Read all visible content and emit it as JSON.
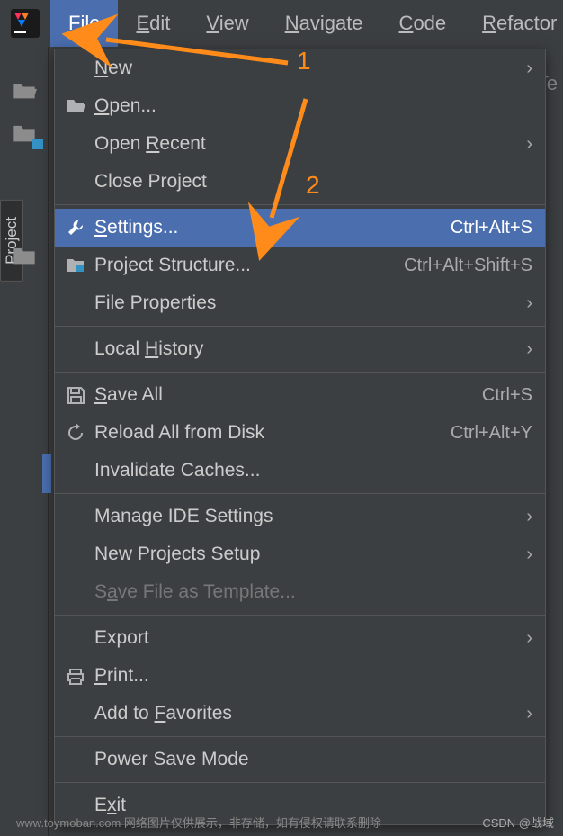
{
  "menubar": {
    "items": [
      {
        "label": "File",
        "mnemonic": 0
      },
      {
        "label": "Edit",
        "mnemonic": 0
      },
      {
        "label": "View",
        "mnemonic": 0
      },
      {
        "label": "Navigate",
        "mnemonic": 0
      },
      {
        "label": "Code",
        "mnemonic": 0
      },
      {
        "label": "Refactor",
        "mnemonic": 0
      }
    ]
  },
  "sidebar": {
    "vertical_tab": "Project"
  },
  "background_partial": "Te",
  "dropdown": {
    "groups": [
      [
        {
          "label": "New",
          "mnemonic": "N",
          "submenu": true
        },
        {
          "label": "Open...",
          "mnemonic": "O",
          "icon": "folder"
        },
        {
          "label": "Open Recent",
          "mnemonic": "R",
          "submenu": true
        },
        {
          "label": "Close Project"
        }
      ],
      [
        {
          "label": "Settings...",
          "mnemonic": "S",
          "icon": "wrench",
          "shortcut": "Ctrl+Alt+S",
          "selected": true
        },
        {
          "label": "Project Structure...",
          "icon": "structure",
          "shortcut": "Ctrl+Alt+Shift+S"
        },
        {
          "label": "File Properties",
          "submenu": true
        }
      ],
      [
        {
          "label": "Local History",
          "mnemonic": "H",
          "submenu": true
        }
      ],
      [
        {
          "label": "Save All",
          "mnemonic": "S",
          "icon": "save",
          "shortcut": "Ctrl+S"
        },
        {
          "label": "Reload All from Disk",
          "icon": "reload",
          "shortcut": "Ctrl+Alt+Y"
        },
        {
          "label": "Invalidate Caches..."
        }
      ],
      [
        {
          "label": "Manage IDE Settings",
          "submenu": true
        },
        {
          "label": "New Projects Setup",
          "submenu": true
        },
        {
          "label": "Save File as Template...",
          "mnemonic": "a",
          "disabled": true
        }
      ],
      [
        {
          "label": "Export",
          "submenu": true
        },
        {
          "label": "Print...",
          "mnemonic": "P",
          "icon": "print"
        },
        {
          "label": "Add to Favorites",
          "mnemonic": "F",
          "submenu": true
        }
      ],
      [
        {
          "label": "Power Save Mode"
        }
      ],
      [
        {
          "label": "Exit",
          "mnemonic": "x"
        }
      ]
    ]
  },
  "annotations": {
    "one": "1",
    "two": "2"
  },
  "watermark": {
    "left": "www.toymoban.com 网络图片仅供展示，非存储，如有侵权请联系删除",
    "right": "CSDN @战域"
  }
}
